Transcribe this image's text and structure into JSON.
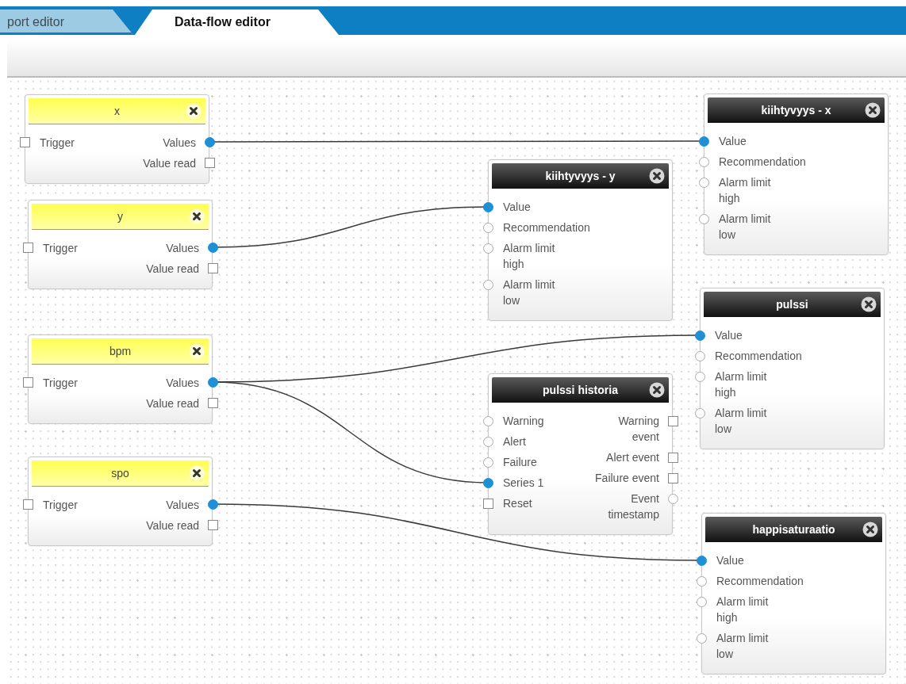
{
  "tabs": [
    {
      "label": "port editor",
      "selected": false
    },
    {
      "label": "Data-flow editor",
      "selected": true
    }
  ],
  "nodes": [
    {
      "title": "x",
      "kind": "source",
      "inputs": [
        {
          "label": "Trigger",
          "kind": "event",
          "connected": false
        }
      ],
      "outputs": [
        {
          "label": "Values",
          "kind": "value",
          "connected": true
        },
        {
          "label": "Value read",
          "kind": "event",
          "connected": false
        }
      ]
    },
    {
      "title": "y",
      "kind": "source",
      "inputs": [
        {
          "label": "Trigger",
          "kind": "event",
          "connected": false
        }
      ],
      "outputs": [
        {
          "label": "Values",
          "kind": "value",
          "connected": true
        },
        {
          "label": "Value read",
          "kind": "event",
          "connected": false
        }
      ]
    },
    {
      "title": "bpm",
      "kind": "source",
      "inputs": [
        {
          "label": "Trigger",
          "kind": "event",
          "connected": false
        }
      ],
      "outputs": [
        {
          "label": "Values",
          "kind": "value",
          "connected": true
        },
        {
          "label": "Value read",
          "kind": "event",
          "connected": false
        }
      ]
    },
    {
      "title": "spo",
      "kind": "source",
      "inputs": [
        {
          "label": "Trigger",
          "kind": "event",
          "connected": false
        }
      ],
      "outputs": [
        {
          "label": "Values",
          "kind": "value",
          "connected": true
        },
        {
          "label": "Value read",
          "kind": "event",
          "connected": false
        }
      ]
    },
    {
      "title": "kiihtyvyys - x",
      "kind": "sink",
      "inputs": [
        {
          "label": "Value",
          "kind": "value",
          "connected": true
        },
        {
          "label": "Recommendation",
          "kind": "value",
          "connected": false
        },
        {
          "label": "Alarm limit\nhigh",
          "kind": "value",
          "connected": false
        },
        {
          "label": "Alarm limit\nlow",
          "kind": "value",
          "connected": false
        }
      ]
    },
    {
      "title": "kiihtyvyys - y",
      "kind": "sink",
      "inputs": [
        {
          "label": "Value",
          "kind": "value",
          "connected": true
        },
        {
          "label": "Recommendation",
          "kind": "value",
          "connected": false
        },
        {
          "label": "Alarm limit\nhigh",
          "kind": "value",
          "connected": false
        },
        {
          "label": "Alarm limit\nlow",
          "kind": "value",
          "connected": false
        }
      ]
    },
    {
      "title": "pulssi",
      "kind": "sink",
      "inputs": [
        {
          "label": "Value",
          "kind": "value",
          "connected": true
        },
        {
          "label": "Recommendation",
          "kind": "value",
          "connected": false
        },
        {
          "label": "Alarm limit\nhigh",
          "kind": "value",
          "connected": false
        },
        {
          "label": "Alarm limit\nlow",
          "kind": "value",
          "connected": false
        }
      ]
    },
    {
      "title": "pulssi historia",
      "kind": "sink",
      "inputs": [
        {
          "label": "Warning",
          "kind": "value",
          "connected": false
        },
        {
          "label": "Alert",
          "kind": "value",
          "connected": false
        },
        {
          "label": "Failure",
          "kind": "value",
          "connected": false
        },
        {
          "label": "Series 1",
          "kind": "value",
          "connected": true
        },
        {
          "label": "Reset",
          "kind": "event",
          "connected": false
        }
      ],
      "outputs": [
        {
          "label": "Warning\nevent",
          "kind": "event",
          "connected": false
        },
        {
          "label": "Alert event",
          "kind": "event",
          "connected": false
        },
        {
          "label": "Failure event",
          "kind": "event",
          "connected": false
        },
        {
          "label": "Event\ntimestamp",
          "kind": "value",
          "connected": false
        }
      ]
    },
    {
      "title": "happisaturaatio",
      "kind": "sink",
      "inputs": [
        {
          "label": "Value",
          "kind": "value",
          "connected": true
        },
        {
          "label": "Recommendation",
          "kind": "value",
          "connected": false
        },
        {
          "label": "Alarm limit\nhigh",
          "kind": "value",
          "connected": false
        },
        {
          "label": "Alarm limit\nlow",
          "kind": "value",
          "connected": false
        }
      ]
    }
  ]
}
